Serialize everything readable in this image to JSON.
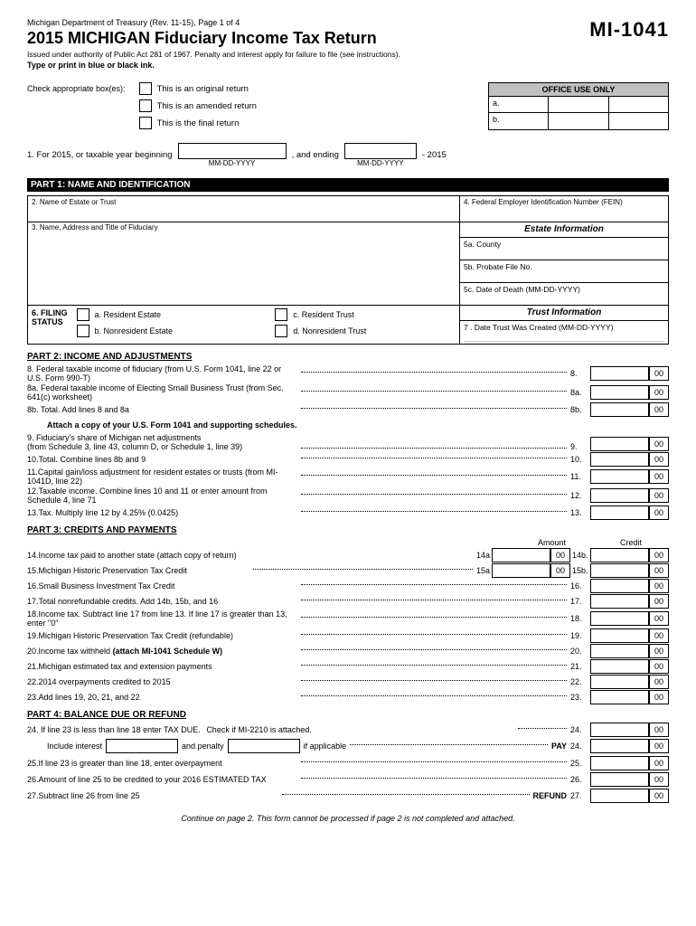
{
  "header": {
    "dept_label": "Michigan Department of Treasury (Rev. 11-15), Page 1 of 4",
    "form_id": "MI-1041",
    "main_title": "2015 MICHIGAN Fiduciary Income Tax Return",
    "subtitle": "Issued under authority of Public Act 281 of 1967.  Penalty and interest apply for failure to file (see instructions).",
    "print_note": "Type or print in blue or black ink."
  },
  "check_section": {
    "label": "Check appropriate box(es):",
    "options": [
      "This is an original return",
      "This is an amended return",
      "This is the final return"
    ]
  },
  "office_use": {
    "title": "OFFICE USE ONLY",
    "rows": [
      {
        "label": "a.",
        "value": ""
      },
      {
        "label": "b.",
        "value": ""
      }
    ]
  },
  "tax_year": {
    "text1": "1.  For 2015, or taxable year beginning",
    "placeholder1": "",
    "date_label1": "MM-DD-YYYY",
    "text2": ", and ending",
    "placeholder2": "",
    "date_label2": "MM-DD-YYYY",
    "year_suffix": "- 2015"
  },
  "part1": {
    "header": "PART 1:  NAME AND IDENTIFICATION",
    "field2_label": "2. Name of Estate or Trust",
    "field4_label": "4. Federal Employer Identification Number (FEIN)",
    "field3_label": "3. Name, Address and Title of Fiduciary",
    "estate_info": {
      "title": "Estate Information",
      "field5a": "5a. County",
      "field5b": "5b. Probate File No.",
      "field5c": "5c. Date of Death (MM-DD-YYYY)"
    },
    "filing_status": {
      "title6": "6. FILING\nSTATUS",
      "options": [
        {
          "id": "a",
          "label": "a. Resident Estate"
        },
        {
          "id": "b",
          "label": "b. Nonresident Estate"
        },
        {
          "id": "c",
          "label": "c. Resident Trust"
        },
        {
          "id": "d",
          "label": "d. Nonresident Trust"
        }
      ]
    },
    "trust_info": {
      "title": "Trust Information",
      "field7_label": "7 . Date Trust Was Created (MM-DD-YYYY)"
    }
  },
  "part2": {
    "header": "PART 2:  INCOME AND ADJUSTMENTS",
    "lines": [
      {
        "num": "8.",
        "desc": "Federal taxable income of fiduciary (from U.S. Form 1041, line 22 or U.S. Form 990-T)",
        "line_ref": "8.",
        "cents": "00"
      },
      {
        "num": "8a.",
        "desc": "Federal taxable income of Electing Small Business Trust (from Sec. 641(c) worksheet)",
        "line_ref": "8a.",
        "cents": "00"
      },
      {
        "num": "8b.",
        "desc": "Total. Add lines 8 and 8a",
        "line_ref": "8b.",
        "cents": "00"
      },
      {
        "num": "",
        "desc": "Attach a copy of your U.S. Form 1041 and supporting schedules.",
        "bold": true
      },
      {
        "num": "9.",
        "desc": "Fiduciary's share of Michigan net adjustments\n(from Schedule 3, line 43, column D, or Schedule 1, line 39)",
        "line_ref": "9.",
        "cents": "00"
      },
      {
        "num": "10.",
        "desc": "Total. Combine lines 8b and 9",
        "line_ref": "10.",
        "cents": "00"
      },
      {
        "num": "11.",
        "desc": "Capital gain/loss adjustment for resident estates or trusts (from MI-1041D, line 22)",
        "line_ref": "11.",
        "cents": "00"
      },
      {
        "num": "12.",
        "desc": "Taxable income. Combine lines 10 and 11 or enter amount from Schedule 4, line 71",
        "line_ref": "12.",
        "cents": "00"
      },
      {
        "num": "13.",
        "desc": "Tax. Multiply line 12 by 4.25% (0.0425)",
        "line_ref": "13.",
        "cents": "00"
      }
    ]
  },
  "part3": {
    "header": "PART 3:  CREDITS AND PAYMENTS",
    "amount_label": "Amount",
    "credit_label": "Credit",
    "lines": [
      {
        "num": "14.",
        "desc": "Income tax paid to another state (attach copy of return)",
        "sub_num": "14a",
        "sub_cents": "00",
        "sub_num2": "14b.",
        "sub_cents2": "00"
      },
      {
        "num": "15.",
        "desc": "Michigan Historic Preservation Tax Credit",
        "sub_num": "15a",
        "sub_cents": "00",
        "sub_num2": "15b.",
        "sub_cents2": "00"
      },
      {
        "num": "16.",
        "desc": "Small Business Investment Tax Credit",
        "line_ref": "16.",
        "cents": "00"
      },
      {
        "num": "17.",
        "desc": "Total nonrefundable credits. Add 14b, 15b, and 16",
        "line_ref": "17.",
        "cents": "00"
      },
      {
        "num": "18.",
        "desc": "Income tax. Subtract line 17 from line 13. If line 17 is greater than 13, enter \"0\"",
        "line_ref": "18.",
        "cents": "00"
      },
      {
        "num": "19.",
        "desc": "Michigan Historic Preservation Tax Credit (refundable)",
        "line_ref": "19.",
        "cents": "00"
      },
      {
        "num": "20.",
        "desc": "Income tax withheld (attach MI-1041 Schedule W)",
        "line_ref": "20.",
        "cents": "00"
      },
      {
        "num": "21.",
        "desc": "Michigan estimated tax and extension payments",
        "line_ref": "21.",
        "cents": "00"
      },
      {
        "num": "22.",
        "desc": "2014 overpayments credited to 2015",
        "line_ref": "22.",
        "cents": "00"
      },
      {
        "num": "23.",
        "desc": "Add lines 19, 20, 21, and 22",
        "line_ref": "23.",
        "cents": "00"
      }
    ]
  },
  "part4": {
    "header": "PART 4:  BALANCE DUE OR REFUND",
    "lines": [
      {
        "num": "24.",
        "desc": "If line 23 is less than line 18 enter TAX DUE.",
        "check_label": "Check if MI-2210 is attached.",
        "include_label": "Include interest",
        "and_penalty": "and penalty",
        "if_applicable": "if applicable",
        "pay_label": "PAY",
        "line_ref": "24.",
        "cents": "00"
      },
      {
        "num": "25.",
        "desc": "If line 23 is greater than line 18, enter overpayment",
        "line_ref": "25.",
        "cents": "00"
      },
      {
        "num": "26.",
        "desc": "Amount of line 25 to be credited to your 2016 ESTIMATED TAX",
        "line_ref": "26.",
        "cents_inline": "00"
      },
      {
        "num": "27.",
        "desc": "Subtract line 26 from line 25",
        "refund_label": "REFUND",
        "line_ref": "27.",
        "cents": "00"
      }
    ]
  },
  "footer": {
    "note": "Continue on page 2. This form cannot be processed if page 2 is not completed and attached."
  }
}
